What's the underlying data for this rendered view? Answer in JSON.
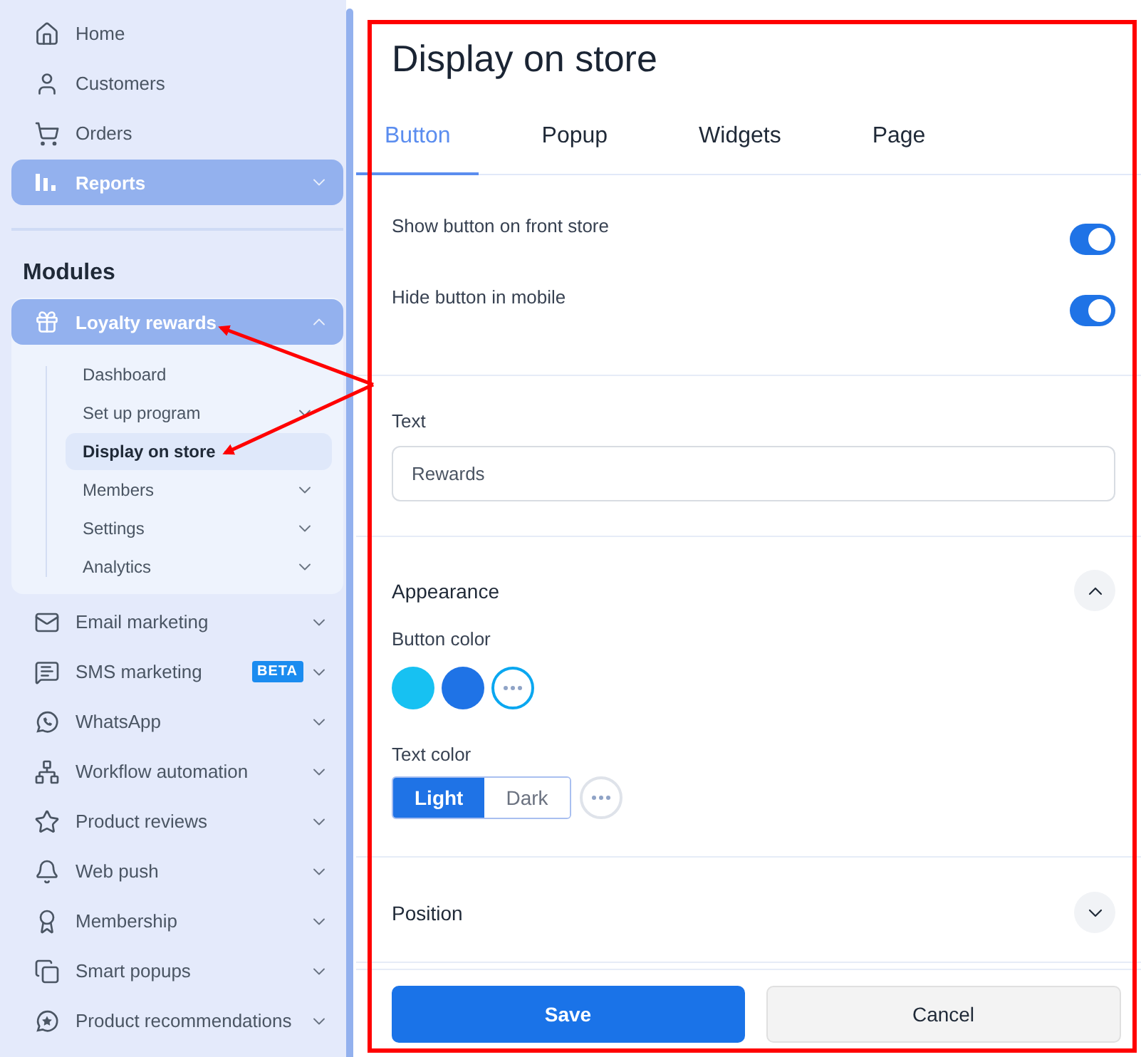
{
  "sidebar": {
    "top_items": [
      {
        "label": "Home",
        "kind": "link",
        "selected": false
      },
      {
        "label": "Customers",
        "kind": "link",
        "selected": false
      },
      {
        "label": "Orders",
        "kind": "link",
        "selected": false
      },
      {
        "label": "Reports",
        "kind": "group",
        "selected": true,
        "expanded": false
      }
    ],
    "modules_heading": "Modules",
    "modules": [
      {
        "label": "Loyalty rewards",
        "selected": true,
        "expanded": true,
        "children": [
          {
            "label": "Dashboard",
            "kind": "link",
            "selected": false
          },
          {
            "label": "Set up program",
            "kind": "group",
            "selected": false,
            "expanded": false
          },
          {
            "label": "Display on store",
            "kind": "link",
            "selected": true
          },
          {
            "label": "Members",
            "kind": "group",
            "selected": false,
            "expanded": false
          },
          {
            "label": "Settings",
            "kind": "group",
            "selected": false,
            "expanded": false
          },
          {
            "label": "Analytics",
            "kind": "group",
            "selected": false,
            "expanded": false
          }
        ]
      },
      {
        "label": "Email marketing",
        "selected": false,
        "expanded": false
      },
      {
        "label": "SMS marketing",
        "selected": false,
        "expanded": false,
        "badge": "BETA"
      },
      {
        "label": "WhatsApp",
        "selected": false,
        "expanded": false
      },
      {
        "label": "Workflow automation",
        "selected": false,
        "expanded": false
      },
      {
        "label": "Product reviews",
        "selected": false,
        "expanded": false
      },
      {
        "label": "Web push",
        "selected": false,
        "expanded": false
      },
      {
        "label": "Membership",
        "selected": false,
        "expanded": false
      },
      {
        "label": "Smart popups",
        "selected": false,
        "expanded": false
      },
      {
        "label": "Product recommendations",
        "selected": false,
        "expanded": false
      }
    ]
  },
  "main": {
    "title": "Display on store",
    "tabs": [
      {
        "label": "Button",
        "selected": true
      },
      {
        "label": "Popup",
        "selected": false
      },
      {
        "label": "Widgets",
        "selected": false
      },
      {
        "label": "Page",
        "selected": false
      }
    ],
    "toggles": [
      {
        "label": "Show button on front store",
        "on": true
      },
      {
        "label": "Hide button in mobile",
        "on": true
      }
    ],
    "text_field": {
      "label": "Text",
      "value": "Rewards"
    },
    "appearance": {
      "title": "Appearance",
      "expanded": true,
      "button_color": {
        "label": "Button color",
        "options": [
          {
            "kind": "swatch",
            "color": "#17c1f2",
            "selected": false
          },
          {
            "kind": "swatch",
            "color": "#1f73e6",
            "selected": false
          },
          {
            "kind": "more",
            "selected": true
          }
        ]
      },
      "text_color": {
        "label": "Text color",
        "options": [
          {
            "label": "Light",
            "selected": true
          },
          {
            "label": "Dark",
            "selected": false
          }
        ],
        "more_selected": false
      }
    },
    "position": {
      "title": "Position",
      "expanded": false
    },
    "buttons": [
      {
        "label": "Save",
        "kind": "primary"
      },
      {
        "label": "Cancel",
        "kind": "secondary"
      }
    ]
  },
  "annotations": [
    {
      "kind": "frame"
    },
    {
      "kind": "arrow"
    },
    {
      "kind": "arrow"
    }
  ]
}
